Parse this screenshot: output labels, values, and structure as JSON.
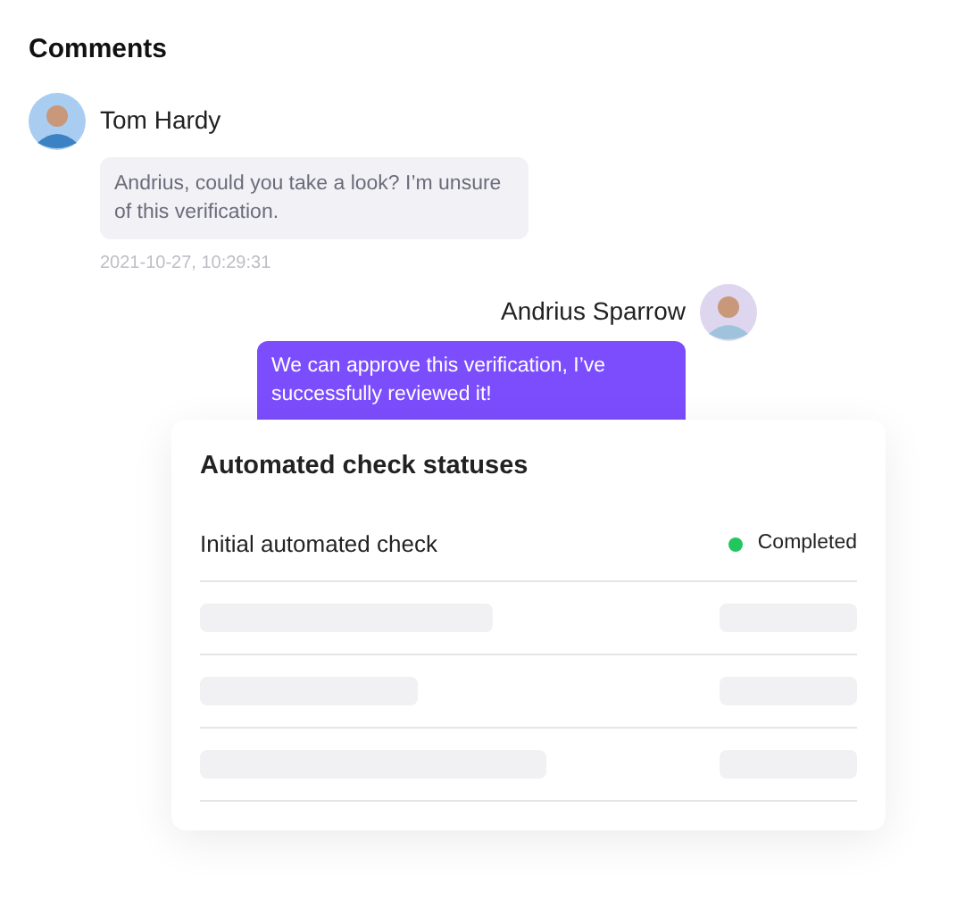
{
  "title": "Comments",
  "comments": [
    {
      "author": "Tom Hardy",
      "kind": "received",
      "text": "Andrius, could you take a look? I’m unsure of this verification.",
      "time": "2021-10-27, 10:29:31"
    },
    {
      "author": "Andrius Sparrow",
      "kind": "sent",
      "text": "We can approve this verification, I’ve successfully reviewed it!"
    }
  ],
  "checks_card": {
    "title": "Automated check statuses",
    "rows": [
      {
        "kind": "check",
        "name": "Initial automated check",
        "status": "Completed",
        "color": "#22c55e"
      },
      {
        "kind": "placeholder"
      },
      {
        "kind": "placeholder"
      },
      {
        "kind": "placeholder"
      }
    ]
  }
}
